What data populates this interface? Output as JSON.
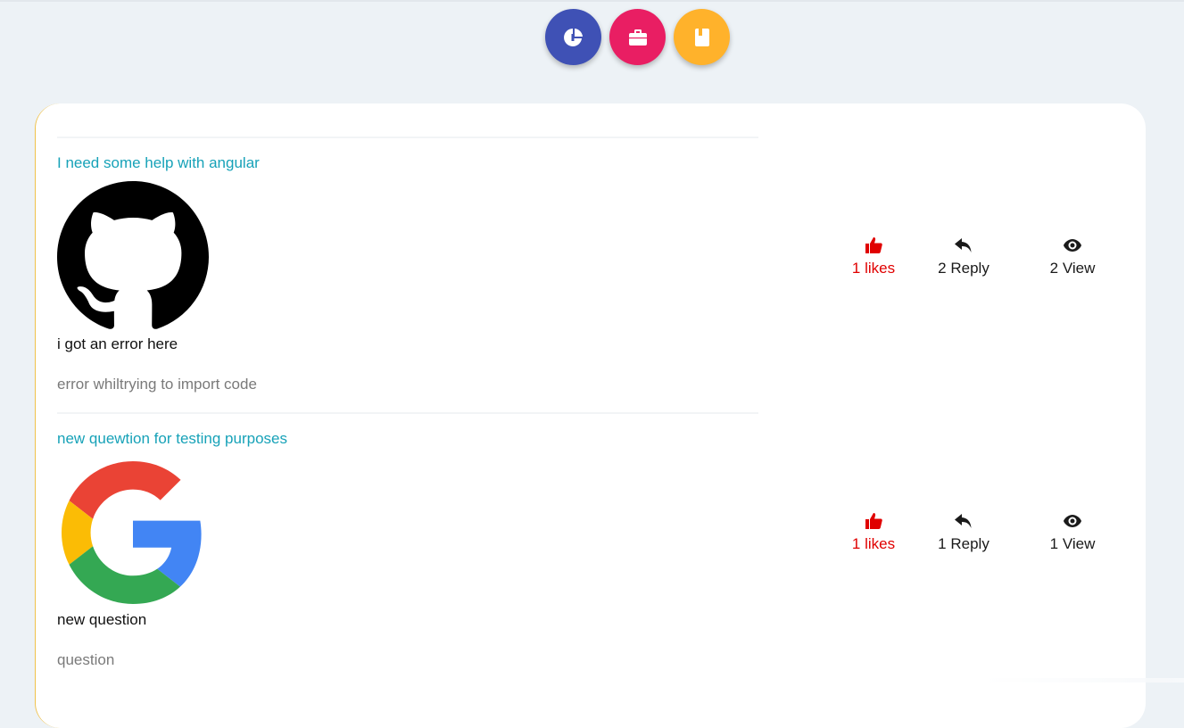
{
  "colors": {
    "background": "#edf2f6",
    "accent_teal": "#17a2b8",
    "like_red": "#e00000",
    "fab_indigo": "#3f51b5",
    "fab_pink": "#e91e63",
    "fab_amber": "#ffb22b",
    "card_border": "#f0c24b"
  },
  "fabs": [
    {
      "icon": "pie-chart-icon",
      "color": "#3f51b5"
    },
    {
      "icon": "briefcase-icon",
      "color": "#e91e63"
    },
    {
      "icon": "book-icon",
      "color": "#ffb22b"
    }
  ],
  "posts": [
    {
      "title": "I need some help with angular",
      "image": "github-logo",
      "question": "i got an error here",
      "description": "error whiltrying to import code",
      "likes": "1 likes",
      "replies": "2 Reply",
      "views": "2 View"
    },
    {
      "title": "new quewtion for testing purposes",
      "image": "google-logo",
      "question": "new question",
      "description": "question",
      "likes": "1 likes",
      "replies": "1 Reply",
      "views": "1 View"
    }
  ]
}
